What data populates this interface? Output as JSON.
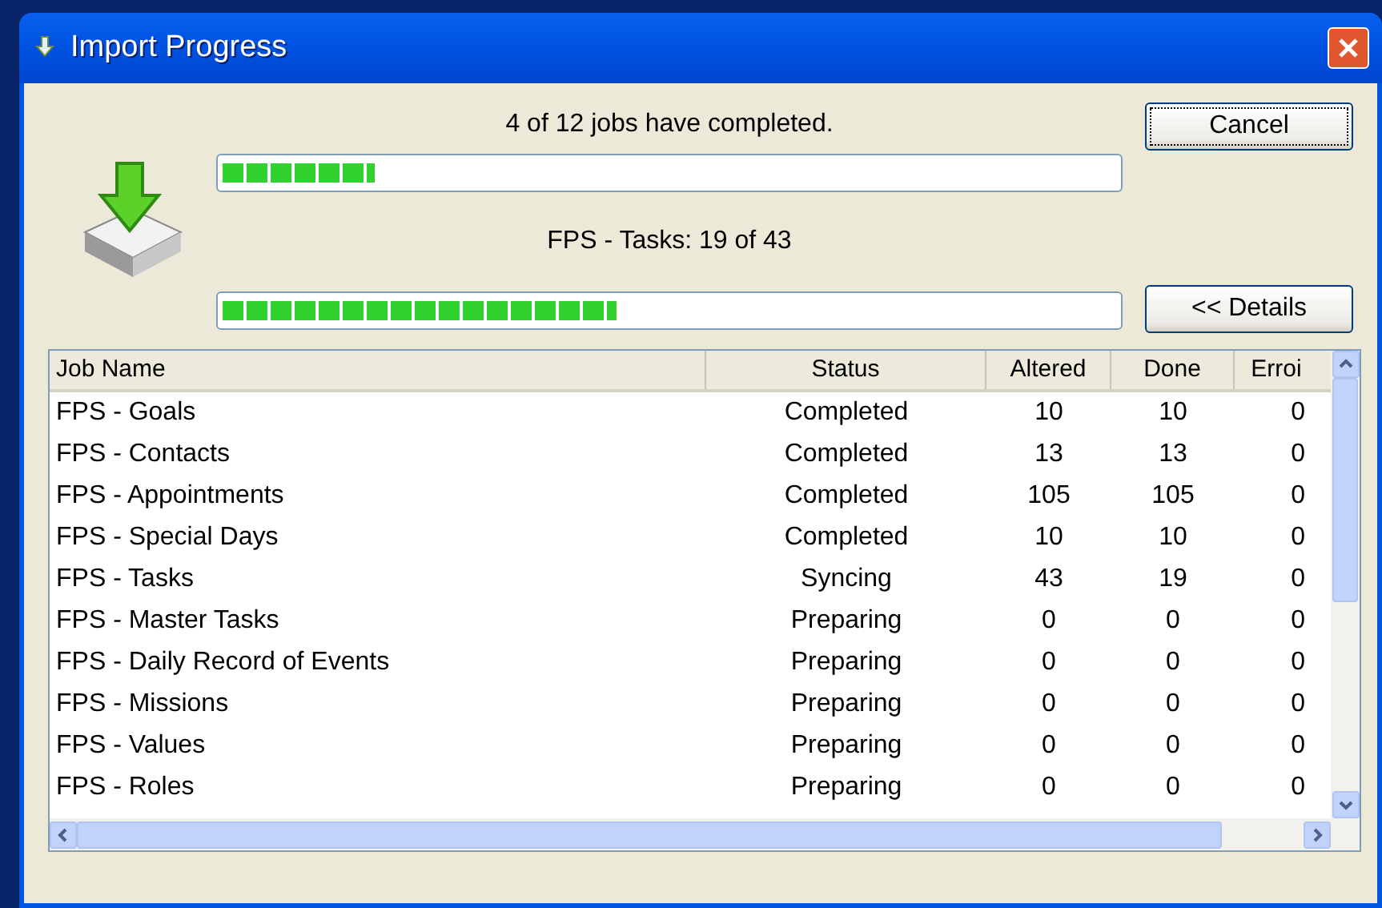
{
  "window": {
    "title": "Import Progress"
  },
  "overall": {
    "message": "4 of 12 jobs have completed.",
    "level": 0.17
  },
  "current": {
    "message": "FPS - Tasks: 19 of 43",
    "level": 0.44
  },
  "buttons": {
    "cancel": "Cancel",
    "details": "<< Details"
  },
  "table": {
    "columns": [
      "Job Name",
      "Status",
      "Altered",
      "Done",
      "Erroi"
    ],
    "rows": [
      [
        "FPS - Goals",
        "Completed",
        "10",
        "10",
        "0"
      ],
      [
        "FPS - Contacts",
        "Completed",
        "13",
        "13",
        "0"
      ],
      [
        "FPS - Appointments",
        "Completed",
        "105",
        "105",
        "0"
      ],
      [
        "FPS - Special Days",
        "Completed",
        "10",
        "10",
        "0"
      ],
      [
        "FPS - Tasks",
        "Syncing",
        "43",
        "19",
        "0"
      ],
      [
        "FPS - Master Tasks",
        "Preparing",
        "0",
        "0",
        "0"
      ],
      [
        "FPS - Daily Record of Events",
        "Preparing",
        "0",
        "0",
        "0"
      ],
      [
        "FPS - Missions",
        "Preparing",
        "0",
        "0",
        "0"
      ],
      [
        "FPS - Values",
        "Preparing",
        "0",
        "0",
        "0"
      ],
      [
        "FPS - Roles",
        "Preparing",
        "0",
        "0",
        "0"
      ]
    ]
  }
}
